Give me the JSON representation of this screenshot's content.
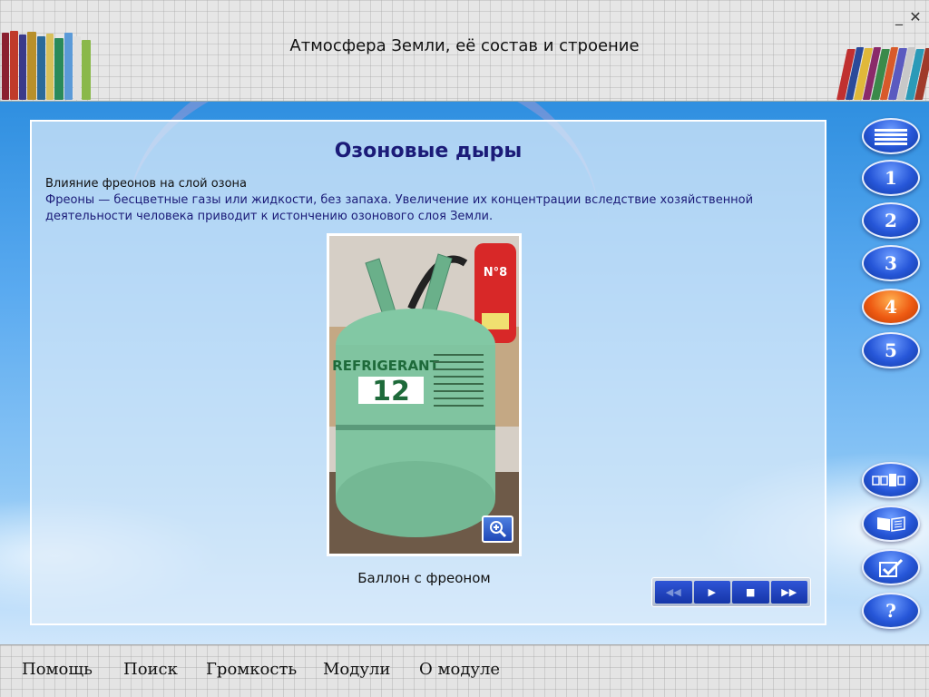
{
  "header": {
    "title": "Атмосфера Земли, её состав и строение",
    "minimize_label": "_",
    "close_label": "✕"
  },
  "slide": {
    "title": "Озоновые дыры",
    "subtitle": "Влияние фреонов на слой озона",
    "body": "Фреоны — бесцветные газы или жидкости, без запаха. Увеличение их концентрации вследствие хозяйственной деятельности человека приводит к истончению озонового слоя Земли.",
    "photo": {
      "cylinder_label_line1": "REFRIGERANT",
      "cylinder_label_number": "12",
      "extinguisher_label": "N°8"
    },
    "caption": "Баллон с фреоном"
  },
  "media_controls": {
    "rewind_label": "◀◀",
    "play_label": "▶",
    "stop_label": "■",
    "forward_label": "▶▶"
  },
  "nav": {
    "menu_icon": "list-icon",
    "pages": [
      {
        "label": "1",
        "active": false
      },
      {
        "label": "2",
        "active": false
      },
      {
        "label": "3",
        "active": false
      },
      {
        "label": "4",
        "active": true
      },
      {
        "label": "5",
        "active": false
      }
    ],
    "tools": [
      "slides-icon",
      "book-icon",
      "checkbox-icon",
      "help-icon"
    ],
    "help_label": "?"
  },
  "footer": {
    "help": "Помощь",
    "search": "Поиск",
    "volume": "Громкость",
    "modules": "Модули",
    "about": "О модуле"
  },
  "colors": {
    "accent_blue": "#2656d8",
    "active_orange": "#ee5a12",
    "title_navy": "#1b1b78",
    "cylinder_green": "#7cc6a2"
  }
}
